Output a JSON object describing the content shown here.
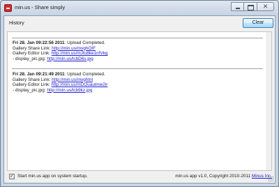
{
  "window": {
    "title": "min.us - Share simply",
    "icon": "minus-app-icon",
    "controls": {
      "minimize": "minimize-icon",
      "maximize": "maximize-icon",
      "close": "✕"
    }
  },
  "toolbar": {
    "history_label": "History",
    "clear_label": "Clear"
  },
  "history": [
    {
      "timestamp": "Fri 28. Jan 09:22:56 2011",
      "status": ": Upload Completed.",
      "lines": [
        {
          "label": "Gallery Share Link: ",
          "link": "http://min.us/mvghOIF"
        },
        {
          "label": "Gallery Editor Link: ",
          "link": "http://min.us/mJfu8ke1nfVkg"
        },
        {
          "label": "- display_pic.jpg: ",
          "link": "http://min.us/lcbD6s.jpg"
        }
      ]
    },
    {
      "timestamp": "Fri 28. Jan 09:21:49 2011",
      "status": ": Upload Completed.",
      "lines": [
        {
          "label": "Gallery Share Link: ",
          "link": "http://min.us/mvghtnl"
        },
        {
          "label": "Gallery Editor Link: ",
          "link": "http://min.us/mDOuaulmw2ir"
        },
        {
          "label": "- display_pic.jpg: ",
          "link": "http://min.us/lcb9kz.jpg"
        }
      ]
    }
  ],
  "footer": {
    "startup_checkbox_checked": true,
    "startup_checkmark": "✓",
    "startup_label": "Start min.us app on system startup.",
    "copyright_text": "min.us app v1.0, Copyright 2010-2011 ",
    "company_link": "Minus Inc."
  }
}
